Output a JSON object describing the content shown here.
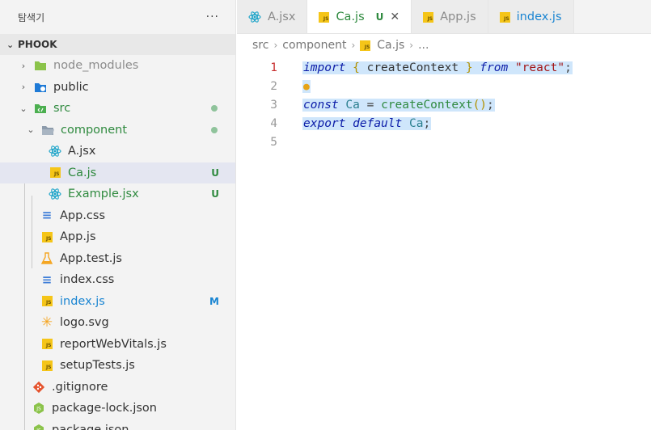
{
  "explorer": {
    "title": "탐색기",
    "more": "···",
    "section": "PHOOK"
  },
  "tree": [
    {
      "label": "node_modules",
      "color": "grey"
    },
    {
      "label": "public",
      "color": "default"
    },
    {
      "label": "src",
      "color": "green"
    },
    {
      "label": "component",
      "color": "green"
    },
    {
      "label": "A.jsx",
      "color": "default"
    },
    {
      "label": "Ca.js",
      "color": "green",
      "badge": "U"
    },
    {
      "label": "Example.jsx",
      "color": "green",
      "badge": "U"
    },
    {
      "label": "App.css",
      "color": "default"
    },
    {
      "label": "App.js",
      "color": "default"
    },
    {
      "label": "App.test.js",
      "color": "default"
    },
    {
      "label": "index.css",
      "color": "default"
    },
    {
      "label": "index.js",
      "color": "blue",
      "badge": "M"
    },
    {
      "label": "logo.svg",
      "color": "default"
    },
    {
      "label": "reportWebVitals.js",
      "color": "default"
    },
    {
      "label": "setupTests.js",
      "color": "default"
    },
    {
      "label": ".gitignore",
      "color": "default"
    },
    {
      "label": "package-lock.json",
      "color": "default"
    },
    {
      "label": "package.json",
      "color": "default"
    }
  ],
  "tabs": [
    {
      "label": "A.jsx"
    },
    {
      "label": "Ca.js",
      "status": "U"
    },
    {
      "label": "App.js"
    },
    {
      "label": "index.js"
    }
  ],
  "breadcrumbs": [
    "src",
    "component",
    "Ca.js",
    "..."
  ],
  "code": {
    "line_numbers": [
      "1",
      "2",
      "3",
      "4",
      "5"
    ],
    "l1": {
      "kw": "import",
      "brace_open": "{",
      "ident": "createContext",
      "brace_close": "}",
      "from": "from",
      "str": "\"react\"",
      "semi": ";"
    },
    "l3": {
      "kw": "const",
      "var": "Ca",
      "eq": "=",
      "fn": "createContext",
      "parens": "()",
      "semi": ";"
    },
    "l4": {
      "kw": "export",
      "kw2": "default",
      "var": "Ca",
      "semi": ";"
    }
  },
  "colors": {
    "accent_green": "#2f8a3f",
    "accent_blue": "#1a85d2",
    "selection": "#cfe6fb",
    "js_icon": "#f5c518",
    "react_icon": "#1aa3c8"
  }
}
